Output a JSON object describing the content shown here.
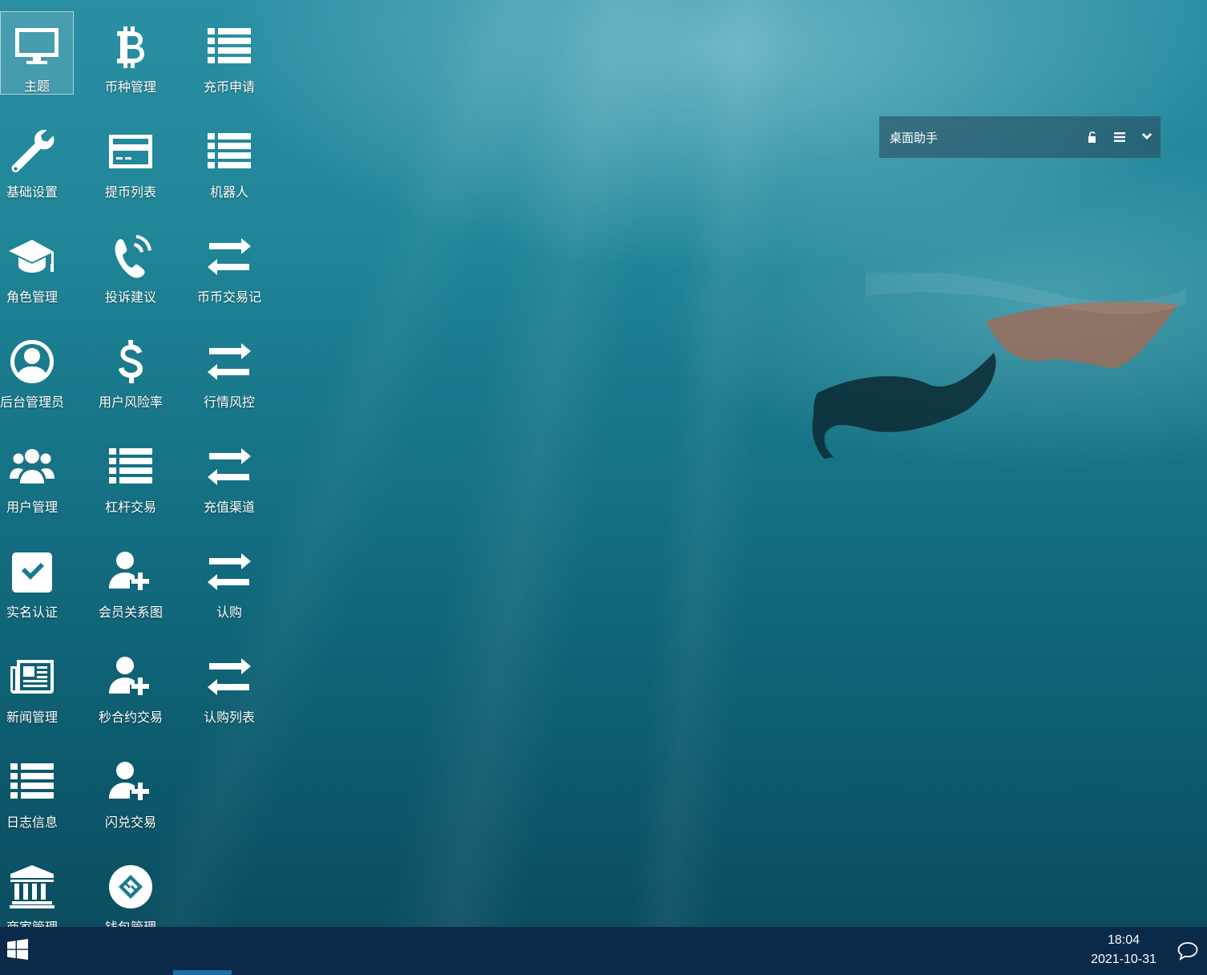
{
  "desktop": {
    "icons": [
      {
        "label": "主题",
        "icon": "monitor-icon"
      },
      {
        "label": "币种管理",
        "icon": "bitcoin-icon"
      },
      {
        "label": "充币申请",
        "icon": "list-icon"
      },
      {
        "label": "基础设置",
        "icon": "wrench-icon"
      },
      {
        "label": "提币列表",
        "icon": "credit-card-icon"
      },
      {
        "label": "机器人",
        "icon": "list-icon"
      },
      {
        "label": "角色管理",
        "icon": "graduation-cap-icon"
      },
      {
        "label": "投诉建议",
        "icon": "phone-volume-icon"
      },
      {
        "label": "币币交易记",
        "icon": "exchange-icon"
      },
      {
        "label": "后台管理员",
        "icon": "user-circle-icon"
      },
      {
        "label": "用户风险率",
        "icon": "dollar-icon"
      },
      {
        "label": "行情风控",
        "icon": "exchange-icon"
      },
      {
        "label": "用户管理",
        "icon": "users-icon"
      },
      {
        "label": "杠杆交易",
        "icon": "list-icon"
      },
      {
        "label": "充值渠道",
        "icon": "exchange-icon"
      },
      {
        "label": "实名认证",
        "icon": "check-square-icon"
      },
      {
        "label": "会员关系图",
        "icon": "user-plus-icon"
      },
      {
        "label": "认购",
        "icon": "exchange-icon"
      },
      {
        "label": "新闻管理",
        "icon": "newspaper-icon"
      },
      {
        "label": "秒合约交易",
        "icon": "user-plus-icon"
      },
      {
        "label": "认购列表",
        "icon": "exchange-icon"
      },
      {
        "label": "日志信息",
        "icon": "list-icon"
      },
      {
        "label": "闪兑交易",
        "icon": "user-plus-icon"
      },
      {
        "label": "商家管理",
        "icon": "bank-icon"
      },
      {
        "label": "钱包管理",
        "icon": "wallet-logo-icon"
      }
    ]
  },
  "widget": {
    "title": "桌面助手",
    "buttons": [
      "unlock-icon",
      "menu-icon",
      "chevron-down-icon"
    ]
  },
  "taskbar": {
    "start_icon": "windows-icon",
    "time": "18:04",
    "date": "2021-10-31",
    "notification_icon": "chat-bubble-icon"
  }
}
